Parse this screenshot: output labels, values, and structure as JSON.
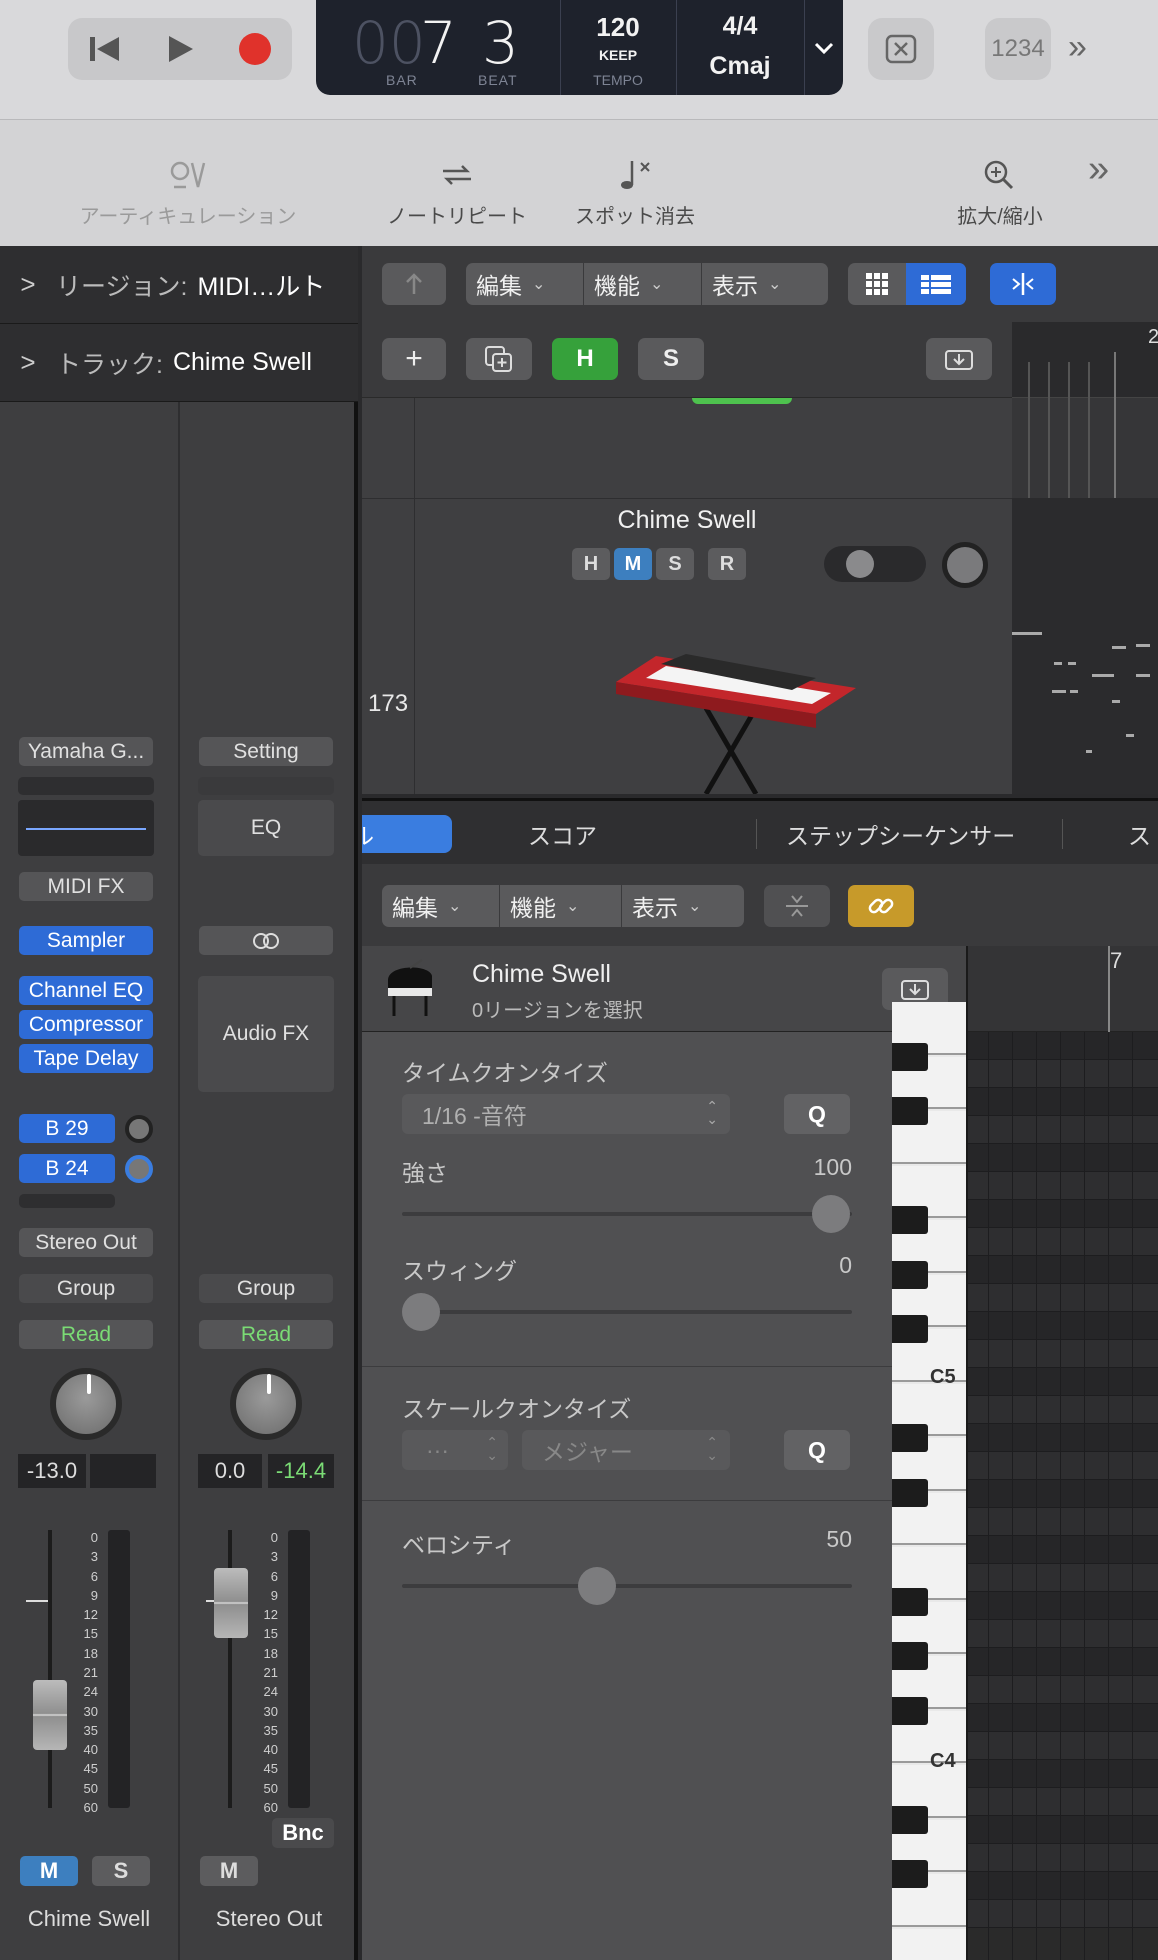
{
  "transport": {
    "bar_dim": "00",
    "bar": "7",
    "beat": "3",
    "bar_label": "BAR",
    "beat_label": "BEAT",
    "tempo": "120",
    "tempo_mode": "KEEP",
    "tempo_label": "TEMPO",
    "signature": "4/4",
    "key": "Cmaj",
    "count_in": "1234"
  },
  "toolbar": {
    "articulation": "アーティキュレーション",
    "note_repeat": "ノートリピート",
    "spot_erase": "スポット消去",
    "zoom": "拡大/縮小"
  },
  "inspector": {
    "region_prefix": "リージョン:",
    "region_name": "MIDI…ルト",
    "track_prefix": "トラック:",
    "track_name": "Chime Swell"
  },
  "strip1": {
    "setting": "Yamaha G...",
    "midi_fx": "MIDI FX",
    "instrument": "Sampler",
    "fx": [
      "Channel EQ",
      "Compressor",
      "Tape Delay"
    ],
    "sends": [
      "B 29",
      "B 24"
    ],
    "output": "Stereo Out",
    "group": "Group",
    "automation": "Read",
    "volume": "-13.0",
    "mute": "M",
    "solo": "S",
    "name": "Chime Swell"
  },
  "strip2": {
    "setting": "Setting",
    "eq": "EQ",
    "audio_fx": "Audio FX",
    "group": "Group",
    "automation": "Read",
    "volume": "0.0",
    "peak": "-14.4",
    "bounce": "Bnc",
    "mute": "M",
    "name": "Stereo Out"
  },
  "meter_scale": [
    "0",
    "3",
    "6",
    "9",
    "12",
    "15",
    "18",
    "21",
    "24",
    "30",
    "35",
    "40",
    "45",
    "50",
    "60"
  ],
  "main_toolbar": {
    "edit": "編集",
    "function": "機能",
    "view": "表示",
    "add": "+",
    "hide": "H",
    "solo": "S"
  },
  "track": {
    "name": "Chime Swell",
    "buttons": [
      "H",
      "M",
      "S",
      "R"
    ],
    "number": "173"
  },
  "ruler": {
    "bar": "2"
  },
  "editor_tabs": {
    "piano_roll": "ピアノロール",
    "score": "スコア",
    "step_sequencer": "ステップシーケンサー",
    "smart_tempo": "ス"
  },
  "editor": {
    "edit": "編集",
    "function": "機能",
    "view": "表示",
    "track_name": "Chime Swell",
    "region_status": "0リージョンを選択",
    "ruler_bar": "7"
  },
  "quantize": {
    "time_label": "タイムクオンタイズ",
    "time_value": "1/16 -音符",
    "q": "Q",
    "strength_label": "強さ",
    "strength_value": "100",
    "swing_label": "スウィング",
    "swing_value": "0",
    "scale_label": "スケールクオンタイズ",
    "scale_root": "···",
    "scale_type": "メジャー",
    "velocity_label": "ベロシティ",
    "velocity_value": "50"
  },
  "piano": {
    "c5": "C5",
    "c4": "C4"
  }
}
